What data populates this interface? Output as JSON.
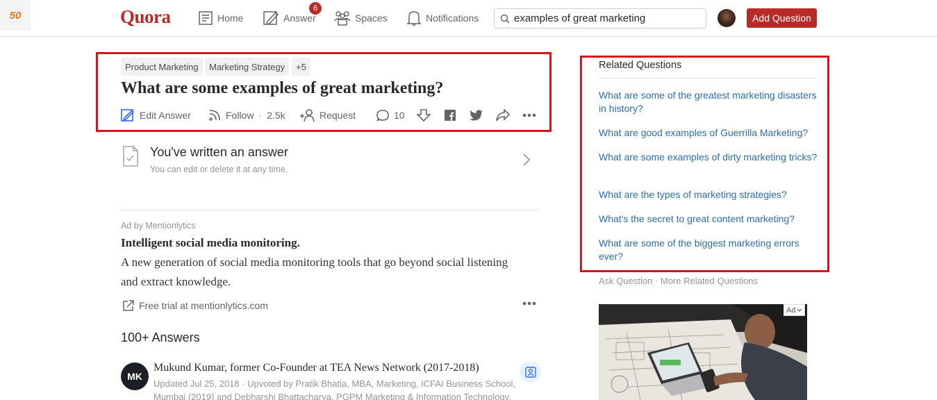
{
  "header": {
    "logo": "Quora",
    "ext_badge": "50",
    "nav": {
      "home": "Home",
      "answer": "Answer",
      "answer_count": "6",
      "spaces": "Spaces",
      "notifications": "Notifications"
    },
    "search_value": "examples of great marketing",
    "add_question": "Add Question",
    "accent": "#b92b27"
  },
  "question": {
    "tags": [
      "Product Marketing",
      "Marketing Strategy",
      "+5"
    ],
    "title": "What are some examples of great marketing?",
    "actions": {
      "edit": "Edit Answer",
      "follow": "Follow",
      "follow_count": "2.5k",
      "request": "Request",
      "comments": "10"
    }
  },
  "written": {
    "title": "You've written an answer",
    "subtitle": "You can edit or delete it at any time."
  },
  "ad": {
    "by": "Ad by Mentionlytics",
    "title": "Intelligent social media monitoring.",
    "body": "A new generation of social media monitoring tools that go beyond social listening and extract knowledge.",
    "link": "Free trial at mentionlytics.com"
  },
  "answers": {
    "count_label": "100+ Answers",
    "first": {
      "avatar_text": "MK",
      "author": "Mukund Kumar, former Co-Founder at TEA News Network (2017-2018)",
      "meta": "Updated Jul 25, 2018 · Upvoted by Pratik Bhatia, MBA, Marketing, ICFAI Business School, Mumbai (2019) and Debharshi Bhattacharya, PGPM Marketing & Information Technology,"
    }
  },
  "related": {
    "title": "Related Questions",
    "items": [
      "What are some of the greatest marketing disasters in history?",
      "What are good examples of Guerrilla Marketing?",
      "What are some examples of dirty marketing tricks?",
      "What are the types of marketing strategies?",
      "What's the secret to great content marketing?",
      "What are some of the biggest marketing errors ever?"
    ],
    "footer": "Ask Question · More Related Questions",
    "link_color": "#2b6dad"
  },
  "sidebar_ad": {
    "tag": "Ad"
  },
  "highlight_color": "#d7121a"
}
